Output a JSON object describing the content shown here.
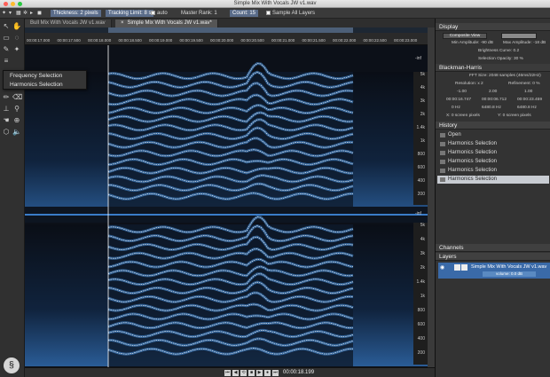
{
  "window": {
    "title": "Simple Mix With Vocals JW v1.wav"
  },
  "toolbar": {
    "thickness": "Thickness: 2 pixels",
    "tracking": "Tracking Limit: 8 s",
    "auto": "auto",
    "master_rank": "Master Rank: 1",
    "count": "Count: 15",
    "sample_all_layers": "Sample All Layers"
  },
  "tabs": [
    {
      "label": "Bull Mix With Vocals JW v1.wav"
    },
    {
      "label": "Simple Mix With Vocals JW v1.wav*"
    }
  ],
  "dropdown": {
    "items": [
      "Frequency Selection",
      "Harmonics Selection"
    ]
  },
  "ruler": {
    "ticks": [
      "00:00:17.000",
      "00:00:17.500",
      "00:00:18.000",
      "00:00:18.500",
      "00:00:19.000",
      "00:00:19.500",
      "00:00:20.000",
      "00:00:20.500",
      "00:00:21.000",
      "00:00:21.500",
      "00:00:22.000",
      "00:00:22.500",
      "00:00:23.000"
    ]
  },
  "freq_labels": [
    "5k",
    "4k",
    "3k",
    "2k",
    "1.4k",
    "1k",
    "800",
    "600",
    "400",
    "200"
  ],
  "inf_label": "-inf",
  "transport": {
    "time": "00:00:18.199"
  },
  "display": {
    "header": "Display",
    "composite_view": "Composite View",
    "min_amp": "Min Amplitude: -90 dB",
    "max_amp": "Max Amplitude: -18 dB",
    "brightness": "Brightness Curve: 0.2",
    "selection_opacity": "Selection Opacity: 30 %",
    "window_fn": "Blackman-Harris",
    "fft_size": "FFT Size: 2048 samples (46ms/22Hz)",
    "resolution": "Resolution: x 2",
    "refinement": "Refinement: 0 %",
    "row1": [
      "-1.00",
      "2.00",
      "1.00"
    ],
    "times": [
      "00:00:16.747",
      "00:00:06.712",
      "00:00:23.459"
    ],
    "hz_row": [
      "0   Hz",
      "6480.8  Hz",
      "6480.8  Hz"
    ],
    "x_screen": "X: 0 screen pixels",
    "y_screen": "Y: 0 screen pixels"
  },
  "history": {
    "header": "History",
    "items": [
      {
        "label": "Open",
        "selected": false
      },
      {
        "label": "Harmonics Selection",
        "selected": false
      },
      {
        "label": "Harmonics Selection",
        "selected": false
      },
      {
        "label": "Harmonics Selection",
        "selected": false
      },
      {
        "label": "Harmonics Selection",
        "selected": false
      },
      {
        "label": "Harmonics Selection",
        "selected": true
      }
    ]
  },
  "channels": {
    "header": "Channels"
  },
  "layers": {
    "header": "Layers",
    "item": "Simple Mix With Vocals JW v1.wav",
    "volume": "volume: 0.0 dB"
  },
  "colors": {
    "accent": "#3a6aa8",
    "spectrum": "#4a8fd8",
    "harmonic": "#ffffff"
  }
}
